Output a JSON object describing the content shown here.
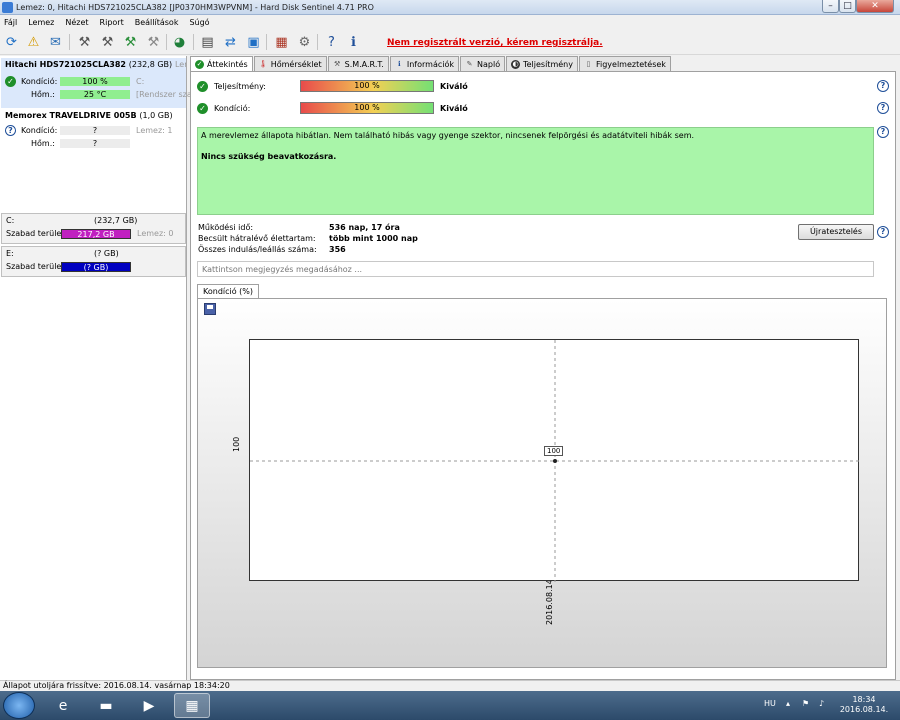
{
  "window": {
    "title": "Lemez: 0, Hitachi HDS721025CLA382 [JP0370HM3WPVNM]  -  Hard Disk Sentinel 4.71 PRO",
    "controls": {
      "minimize": "–",
      "maximize": "□",
      "close": "✕"
    }
  },
  "menu": [
    "Fájl",
    "Lemez",
    "Nézet",
    "Riport",
    "Beállítások",
    "Súgó"
  ],
  "toolbar": {
    "register_link": "Nem regisztrált verzió, kérem regisztrálja."
  },
  "left": {
    "disks": [
      {
        "name": "Hitachi HDS721025CLA382",
        "size": "(232,8 GB)",
        "extra": "Lemez",
        "rows": [
          {
            "label": "Kondíció:",
            "value": "100 %",
            "side": "C:"
          },
          {
            "label": "Hőm.:",
            "value": "25 °C",
            "side": "[Rendszer sza"
          }
        ]
      },
      {
        "name": "Memorex TRAVELDRIVE 005B",
        "size": "(1,0 GB)",
        "rows": [
          {
            "label": "Kondíció:",
            "value": "?",
            "side": "Lemez: 1"
          },
          {
            "label": "Hőm.:",
            "value": "?"
          }
        ]
      }
    ],
    "volumes": [
      {
        "letter": "C:",
        "size": "(232,7 GB)",
        "free_label": "Szabad terület",
        "free": "217,2 GB",
        "side": "Lemez: 0",
        "color": "#c020c0"
      },
      {
        "letter": "E:",
        "size": "(? GB)",
        "free_label": "Szabad terület",
        "free": "(? GB)",
        "color": "#0000c0"
      }
    ]
  },
  "tabs": [
    {
      "label": "Áttekintés",
      "active": true
    },
    {
      "label": "Hőmérséklet"
    },
    {
      "label": "S.M.A.R.T."
    },
    {
      "label": "Információk"
    },
    {
      "label": "Napló"
    },
    {
      "label": "Teljesítmény"
    },
    {
      "label": "Figyelmeztetések"
    }
  ],
  "overview": {
    "performance": {
      "label": "Teljesítmény:",
      "bar": "100 %",
      "value": "Kiváló"
    },
    "condition": {
      "label": "Kondíció:",
      "bar": "100 %",
      "value": "Kiváló"
    },
    "message": "A merevlemez állapota hibátlan. Nem található hibás vagy gyenge szektor, nincsenek felpörgési és adatátviteli hibák sem.",
    "action": "Nincs szükség beavatkozásra.",
    "stats": [
      {
        "label": "Működési idő:",
        "value": "536 nap, 17 óra"
      },
      {
        "label": "Becsült hátralévő élettartam:",
        "value": "több mint 1000 nap"
      },
      {
        "label": "Összes indulás/leállás száma:",
        "value": "356"
      }
    ],
    "retest_button": "Újratesztelés",
    "note_placeholder": "Kattintson megjegyzés megadásához ..."
  },
  "chart_tab": "Kondíció  (%)",
  "chart_data": {
    "type": "line",
    "x": [
      "2016.08.14."
    ],
    "series": [
      {
        "values": [
          100
        ]
      }
    ],
    "ytick_labels": [
      "100"
    ],
    "xtick_labels": [
      "2016.08.14."
    ],
    "data_labels": [
      "100"
    ]
  },
  "status": "Állapot utoljára frissítve: 2016.08.14. vasárnap 18:34:20",
  "taskbar": {
    "lang": "HU",
    "time": "18:34",
    "date": "2016.08.14."
  }
}
